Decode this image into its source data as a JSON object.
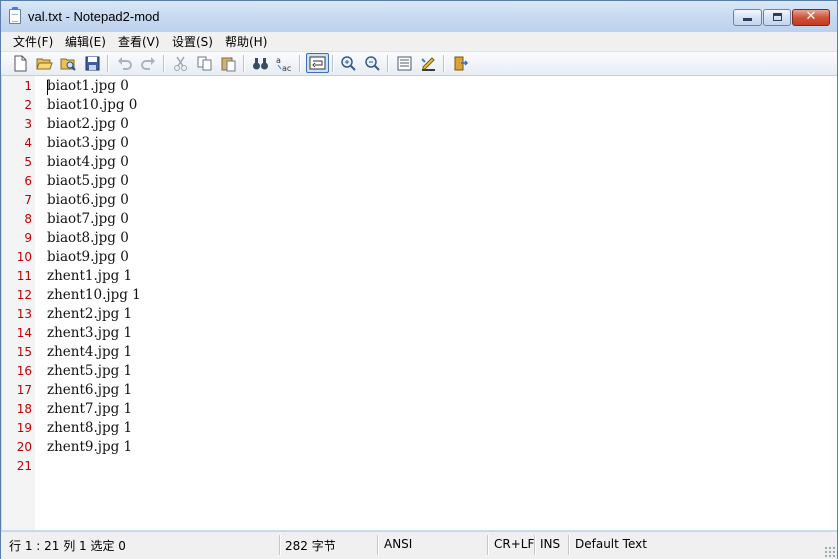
{
  "window": {
    "title": "val.txt - Notepad2-mod",
    "icon": "notepad-icon",
    "controls": {
      "minimize": "minimize-icon",
      "maximize": "maximize-icon",
      "close": "✕"
    }
  },
  "menu": {
    "items": [
      "文件(F)",
      "编辑(E)",
      "查看(V)",
      "设置(S)",
      "帮助(H)"
    ]
  },
  "toolbar": {
    "buttons": [
      {
        "name": "new-file",
        "icon": "new-file-icon"
      },
      {
        "name": "open-file",
        "icon": "open-folder-icon"
      },
      {
        "name": "browse",
        "icon": "browse-icon"
      },
      {
        "name": "save",
        "icon": "save-icon"
      },
      {
        "name": "undo",
        "icon": "undo-icon"
      },
      {
        "name": "redo",
        "icon": "redo-icon"
      },
      {
        "name": "cut",
        "icon": "cut-icon"
      },
      {
        "name": "copy",
        "icon": "copy-icon"
      },
      {
        "name": "paste",
        "icon": "paste-icon"
      },
      {
        "name": "find",
        "icon": "binoculars-icon"
      },
      {
        "name": "replace",
        "icon": "replace-icon"
      },
      {
        "name": "word-wrap",
        "icon": "word-wrap-icon",
        "pressed": true
      },
      {
        "name": "zoom-in",
        "icon": "zoom-in-icon"
      },
      {
        "name": "zoom-out",
        "icon": "zoom-out-icon"
      },
      {
        "name": "scheme",
        "icon": "scheme-icon"
      },
      {
        "name": "customize-scheme",
        "icon": "customize-scheme-icon"
      },
      {
        "name": "exit",
        "icon": "exit-icon"
      }
    ]
  },
  "editor": {
    "lines": [
      "biaot1.jpg 0",
      "biaot10.jpg 0",
      "biaot2.jpg 0",
      "biaot3.jpg 0",
      "biaot4.jpg 0",
      "biaot5.jpg 0",
      "biaot6.jpg 0",
      "biaot7.jpg 0",
      "biaot8.jpg 0",
      "biaot9.jpg 0",
      "zhent1.jpg 1",
      "zhent10.jpg 1",
      "zhent2.jpg 1",
      "zhent3.jpg 1",
      "zhent4.jpg 1",
      "zhent5.jpg 1",
      "zhent6.jpg 1",
      "zhent7.jpg 1",
      "zhent8.jpg 1",
      "zhent9.jpg 1",
      ""
    ],
    "line_numbers": [
      "1",
      "2",
      "3",
      "4",
      "5",
      "6",
      "7",
      "8",
      "9",
      "10",
      "11",
      "12",
      "13",
      "14",
      "15",
      "16",
      "17",
      "18",
      "19",
      "20",
      "21"
    ]
  },
  "statusbar": {
    "position": "行 1 : 21    列 1    选定 0",
    "size": "282 字节",
    "encoding": "ANSI",
    "eol": "CR+LF",
    "insert_mode": "INS",
    "scheme": "Default Text"
  },
  "colors": {
    "line_number": "#c20000",
    "title_bar": "#c6d9f0",
    "close_button": "#c9452b"
  }
}
